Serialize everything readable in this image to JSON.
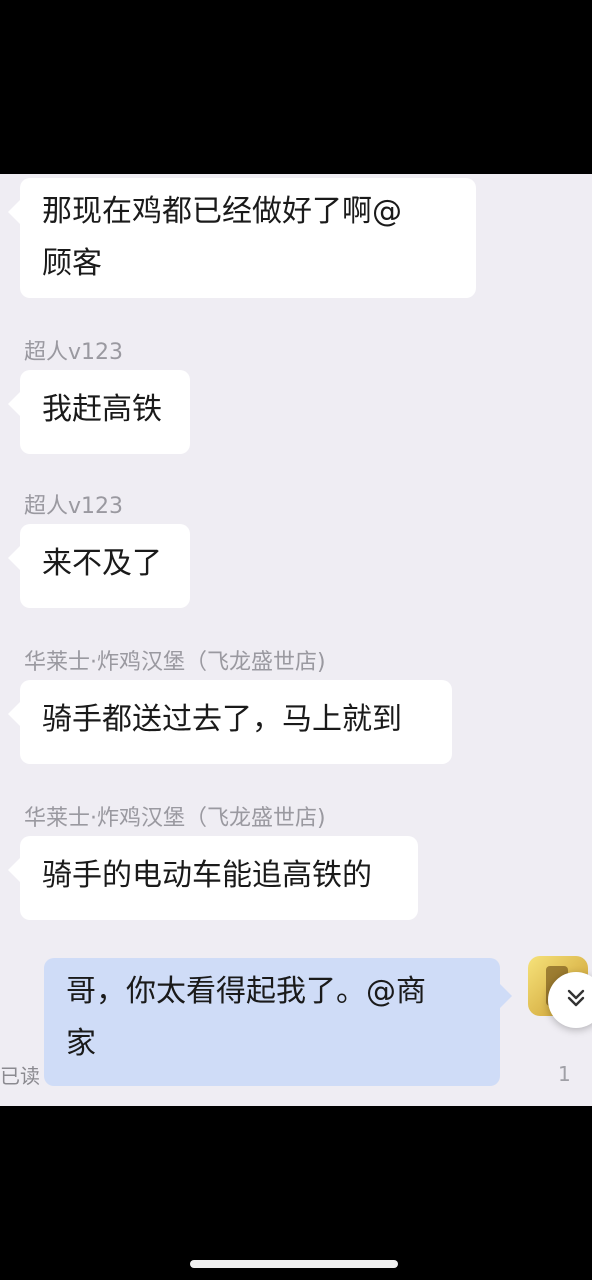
{
  "messages": [
    {
      "sender": "",
      "text_lines": [
        "那现在鸡都已经做好了啊@",
        "顾客"
      ]
    },
    {
      "sender": "超人v123",
      "text_lines": [
        "我赶高铁"
      ]
    },
    {
      "sender": "超人v123",
      "text_lines": [
        "来不及了"
      ]
    },
    {
      "sender": "华莱士·炸鸡汉堡（飞龙盛世店)",
      "text_lines": [
        "骑手都送过去了，马上就到"
      ]
    },
    {
      "sender": "华莱士·炸鸡汉堡（飞龙盛世店)",
      "text_lines": [
        "骑手的电动车能追高铁的"
      ]
    },
    {
      "sender": "",
      "text_lines": [
        "哥，你太看得起我了。@商",
        "家"
      ]
    }
  ],
  "read_status": "已读",
  "unread_count": "1",
  "icons": {
    "scroll_down": "chevron-double-down-icon",
    "avatar": "user-avatar"
  }
}
